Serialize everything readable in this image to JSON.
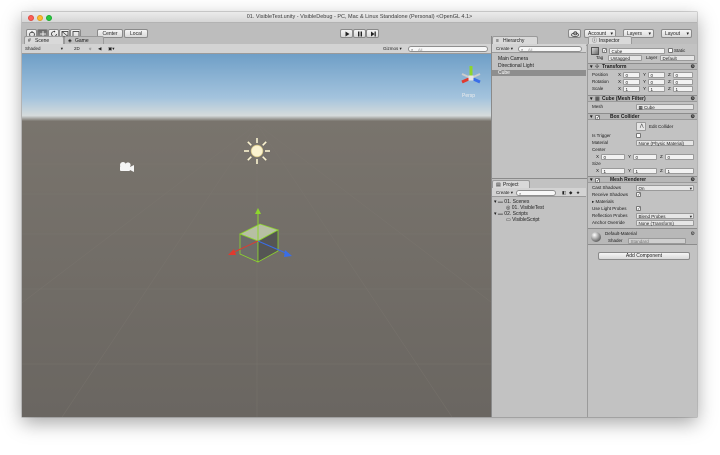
{
  "window": {
    "title": "01. VisibleTest.unity - VisibleDebug - PC, Mac & Linux Standalone (Personal) <OpenGL 4.1>"
  },
  "colors": {
    "sky_top": "#6f9fc7",
    "ground": "#6a6661",
    "panel_bg": "#c2c2c2",
    "selection": "#3e7de7",
    "cube_green": "#8dd62c",
    "axis_x": "#e03a2f",
    "axis_y": "#8dd62c",
    "axis_z": "#3a6ee8"
  },
  "toolbar": {
    "tools": [
      "hand-icon",
      "move-icon",
      "rotate-icon",
      "scale-icon",
      "rect-icon"
    ],
    "pivot_label": "Center",
    "space_label": "Local",
    "play_controls": [
      "play-icon",
      "pause-icon",
      "step-icon"
    ],
    "cloud_icon": "cloud-icon",
    "account_label": "Account",
    "layers_label": "Layers",
    "layout_label": "Layout"
  },
  "scene_view": {
    "tabs": [
      {
        "label": "Scene",
        "active": true
      },
      {
        "label": "Game",
        "active": false
      }
    ],
    "shading_mode": "Shaded",
    "mode_2d_label": "2D",
    "gizmos_label": "Gizmos",
    "search_placeholder": "All",
    "persp_label": "Persp"
  },
  "hierarchy": {
    "tab_label": "Hierarchy",
    "create_label": "Create",
    "search_placeholder": "All",
    "items": [
      {
        "label": "Main Camera",
        "selected": false
      },
      {
        "label": "Directional Light",
        "selected": false
      },
      {
        "label": "Cube",
        "selected": true
      }
    ]
  },
  "project": {
    "tab_label": "Project",
    "create_label": "Create",
    "tree": [
      {
        "label": "01. Scenes",
        "icon": "folder-icon",
        "level": 0
      },
      {
        "label": "01. VisibleTest",
        "icon": "unity-scene-icon",
        "level": 1
      },
      {
        "label": "02. Scripts",
        "icon": "folder-icon",
        "level": 0
      },
      {
        "label": "VisibleScript",
        "icon": "script-icon",
        "level": 1
      }
    ]
  },
  "inspector": {
    "tab_label": "Inspector",
    "object_name": "Cube",
    "static_label": "Static",
    "tag_label": "Tag",
    "tag_value": "Untagged",
    "layer_label": "Layer",
    "layer_value": "Default",
    "transform": {
      "title": "Transform",
      "rows": [
        {
          "label": "Position",
          "x": "0",
          "y": "0",
          "z": "0"
        },
        {
          "label": "Rotation",
          "x": "0",
          "y": "0",
          "z": "0"
        },
        {
          "label": "Scale",
          "x": "1",
          "y": "1",
          "z": "1"
        }
      ]
    },
    "mesh_filter": {
      "title": "Cube (Mesh Filter)",
      "mesh_label": "Mesh",
      "mesh_value": "Cube"
    },
    "box_collider": {
      "title": "Box Collider",
      "edit_label": "Edit Collider",
      "is_trigger_label": "Is Trigger",
      "material_label": "Material",
      "material_value": "None (Physic Material)",
      "center_label": "Center",
      "center": {
        "x": "0",
        "y": "0",
        "z": "0"
      },
      "size_label": "Size",
      "size": {
        "x": "1",
        "y": "1",
        "z": "1"
      }
    },
    "mesh_renderer": {
      "title": "Mesh Renderer",
      "cast_shadows_label": "Cast Shadows",
      "cast_shadows_value": "On",
      "receive_shadows_label": "Receive Shadows",
      "materials_label": "Materials",
      "light_probes_label": "Use Light Probes",
      "reflection_probes_label": "Reflection Probes",
      "reflection_probes_value": "Blend Probes",
      "anchor_override_label": "Anchor Override",
      "anchor_override_value": "None (Transform)"
    },
    "material": {
      "name": "Default-Material",
      "shader_label": "Shader",
      "shader_value": "Standard"
    },
    "add_component_label": "Add Component"
  },
  "axis_labels": {
    "x": "X",
    "y": "Y",
    "z": "Z"
  }
}
